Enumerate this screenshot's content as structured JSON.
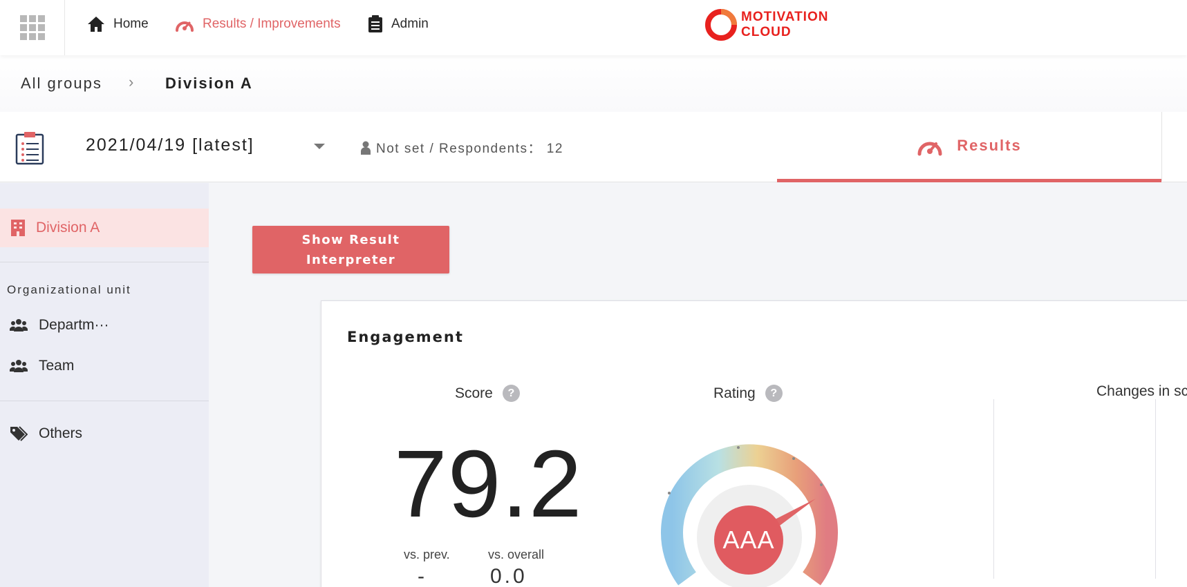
{
  "topnav": {
    "home": "Home",
    "results": "Results / Improvements",
    "admin": "Admin",
    "brand_line1": "MOTIVATION",
    "brand_line2": "CLOUD"
  },
  "breadcrumb": {
    "root": "All groups",
    "separator": "›",
    "current": "Division A"
  },
  "survey": {
    "date": "2021/04/19 [latest]",
    "respondents": "Not set / Respondents： 12",
    "tab_results": "Results"
  },
  "sidebar": {
    "active_item": "Division A",
    "section_heading": "Organizational unit",
    "items": [
      {
        "label": "Departm···",
        "icon": "users-icon"
      },
      {
        "label": "Team",
        "icon": "users-icon"
      }
    ],
    "others": "Others"
  },
  "main": {
    "interpreter_button_line1": "Show Result",
    "interpreter_button_line2": "Interpreter",
    "card_title": "Engagement",
    "score_label": "Score",
    "score_value": "79.2",
    "rating_label": "Rating",
    "rating_value": "AAA",
    "vs_prev_label": "vs. prev.",
    "vs_prev_value": "-",
    "vs_overall_label": "vs. overall",
    "vs_overall_value": "0.0",
    "changes_label": "Changes in sc",
    "help_glyph": "?"
  },
  "colors": {
    "accent": "#e06466",
    "brand": "#e8211e",
    "sidebar_bg": "#ecedf5",
    "active_bg": "#fbe3e3"
  }
}
